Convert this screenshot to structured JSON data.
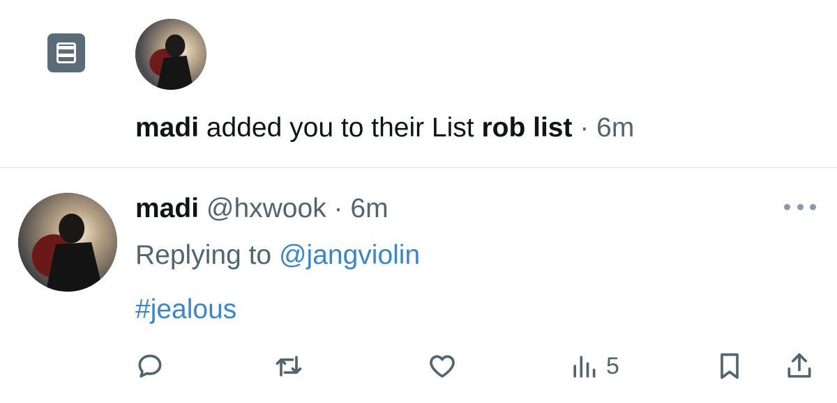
{
  "notification": {
    "icon": "list-icon",
    "actor": "madi",
    "text": " added you to their List ",
    "list_name": "rob list",
    "sep": " · ",
    "time": "6m"
  },
  "tweet": {
    "display_name": "madi",
    "handle": " @hxwook",
    "sep": " · ",
    "time": "6m",
    "replying_prefix": "Replying to ",
    "replying_to": "@jangviolin",
    "hashtag": "#jealous"
  },
  "actions": {
    "reply": {
      "icon": "reply-icon"
    },
    "retweet": {
      "icon": "retweet-icon"
    },
    "like": {
      "icon": "heart-icon"
    },
    "views": {
      "icon": "views-icon",
      "count": "5"
    },
    "bookmark": {
      "icon": "bookmark-icon"
    },
    "share": {
      "icon": "share-icon"
    }
  },
  "colors": {
    "link": "#3a86c8",
    "muted": "#536471",
    "icon": "#5b6b78"
  }
}
